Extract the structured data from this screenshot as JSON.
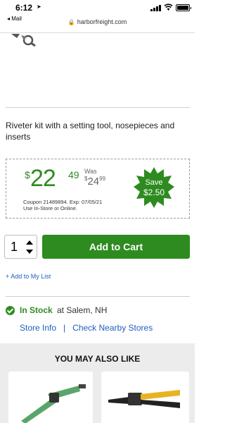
{
  "status_bar": {
    "time": "6:12",
    "back_app": "◂ Mail"
  },
  "url_bar": {
    "domain": "harborfreight.com"
  },
  "product": {
    "description": "Riveter kit with a setting tool, nosepieces and inserts"
  },
  "pricing": {
    "dollar_sign": "$",
    "price_whole": "22",
    "price_cents": "49",
    "was_label": "Was",
    "was_dollar": "$",
    "was_whole": "24",
    "was_cents": "99",
    "coupon_line1": "Coupon 21489894. Exp: 07/05/21",
    "coupon_line2": "Use In-Store or Online.",
    "save_label": "Save",
    "save_amount": "$2.50",
    "colors": {
      "price_green": "#2e8b20",
      "badge_green": "#2e8b20"
    }
  },
  "purchase": {
    "quantity": "1",
    "add_to_cart_label": "Add to Cart",
    "add_to_list_label": "+ Add to My List"
  },
  "availability": {
    "in_stock_label": "In Stock",
    "store_text": "at Salem, NH",
    "store_info_link": "Store Info",
    "separator": "|",
    "nearby_link": "Check Nearby Stores"
  },
  "recommendations": {
    "title": "YOU MAY ALSO LIKE"
  }
}
